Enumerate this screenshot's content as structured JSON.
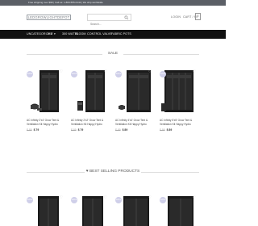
{
  "topbar": {
    "text": "Free shipping over $99 | Call us: 1-800-555-0142 | We ship worldwide"
  },
  "header": {
    "logo": "LEDGROWLIGHTDEPOT",
    "search_placeholder": "Search...",
    "login_label": "LOGIN",
    "cart_label": "CART / $0",
    "cart_count": "0"
  },
  "nav": {
    "items": [
      "UNCATEGORIZED",
      "▾ 6' ▾",
      "300 WATTS",
      "BLOOM",
      "CONTROL VALVE",
      "FABRIC POTS"
    ]
  },
  "sale_section": {
    "title": "SALE",
    "products": [
      {
        "badge": "SALE",
        "title": "AC Infinity 2'x4' Grow Tent & Ventilation Kit Happy Hydro",
        "old_price": "$ 89",
        "new_price": "$ 79"
      },
      {
        "badge": "SALE",
        "title": "AC Infinity 2'x2' Grow Tent & Ventilation Kit Happy Hydro",
        "old_price": "$ 89",
        "new_price": "$ 79"
      },
      {
        "badge": "SALE",
        "title": "AC Infinity 4'x4' Grow Tent & Ventilation Kit Happy Hydro",
        "old_price": "$ 99",
        "new_price": "$ 89"
      },
      {
        "badge": "SALE",
        "title": "AC Infinity 5'x5' Grow Tent & Ventilation Kit Happy Hydro",
        "old_price": "$ 99",
        "new_price": "$ 89"
      }
    ]
  },
  "best_section": {
    "title": "BEST SELLING PRODUCTS",
    "products": [
      {
        "badge": "SALE"
      },
      {
        "badge": "SALE"
      },
      {
        "badge": "SALE"
      },
      {
        "badge": "SALE"
      }
    ]
  },
  "colors": {
    "topbar": "#5b5f66",
    "navbar": "#111111",
    "badge": "#cfcfe9",
    "tent": "#1a1a1a"
  }
}
